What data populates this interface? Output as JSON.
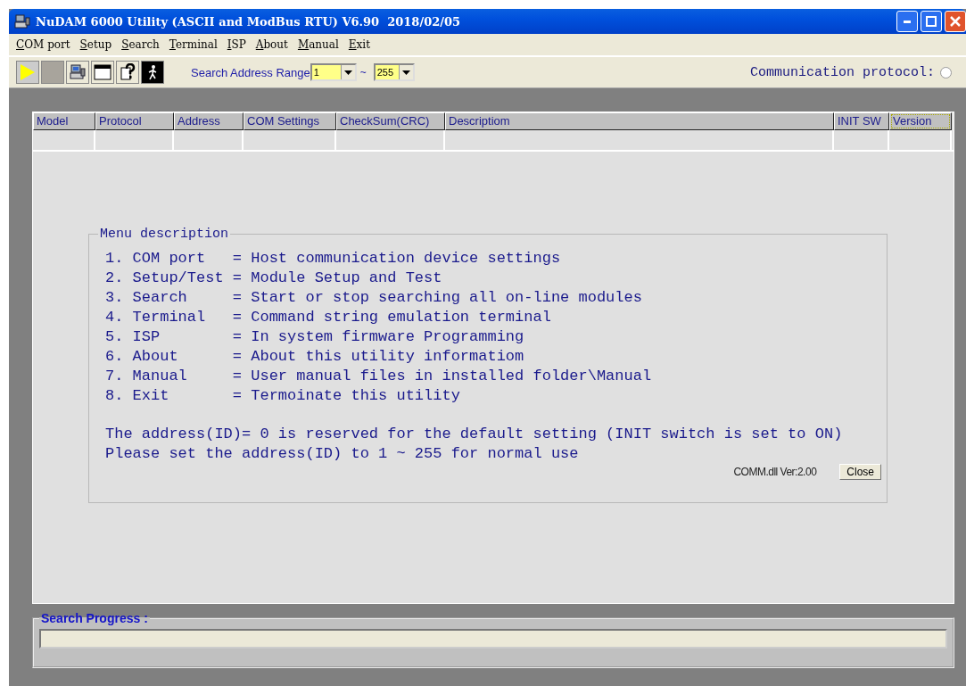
{
  "window": {
    "title": "NuDAM 6000 Utility (ASCII and ModBus RTU) V6.90  2018/02/05"
  },
  "menu": [
    "COM port",
    "Setup",
    "Search",
    "Terminal",
    "ISP",
    "About",
    "Manual",
    "Exit"
  ],
  "toolbar": {
    "buttons": [
      {
        "kind": "play"
      },
      {
        "kind": "stop"
      },
      {
        "kind": "computer"
      },
      {
        "kind": "window"
      },
      {
        "kind": "help"
      },
      {
        "kind": "exit"
      }
    ],
    "range_label": "Search Address Range",
    "range_from": "1",
    "range_separator": "~",
    "range_to": "255",
    "protocol_label": "Communication protocol:",
    "protocol_checked": false
  },
  "table": {
    "columns": [
      "Model",
      "Protocol",
      "Address",
      "COM Settings",
      "CheckSum(CRC)",
      "Descriptiom",
      "INIT SW",
      "Version"
    ]
  },
  "menu_description": {
    "title": "Menu description",
    "lines": [
      "1. COM port   = Host communication device settings",
      "2. Setup/Test = Module Setup and Test",
      "3. Search     = Start or stop searching all on-line modules",
      "4. Terminal   = Command string emulation terminal",
      "5. ISP        = In system firmware Programming",
      "6. About      = About this utility informatiom",
      "7. Manual     = User manual files in installed folder\\Manual",
      "8. Exit       = Termoinate this utility"
    ],
    "notes": [
      "The address(ID)= 0 is reserved for the default setting (INIT switch is set to ON)",
      "Please set the address(ID) to 1 ~ 255 for normal use"
    ],
    "dll_version": "COMM.dll Ver:2.00",
    "close_button": "Close"
  },
  "search_progress": {
    "title": "Search Progress :",
    "level": 0
  }
}
